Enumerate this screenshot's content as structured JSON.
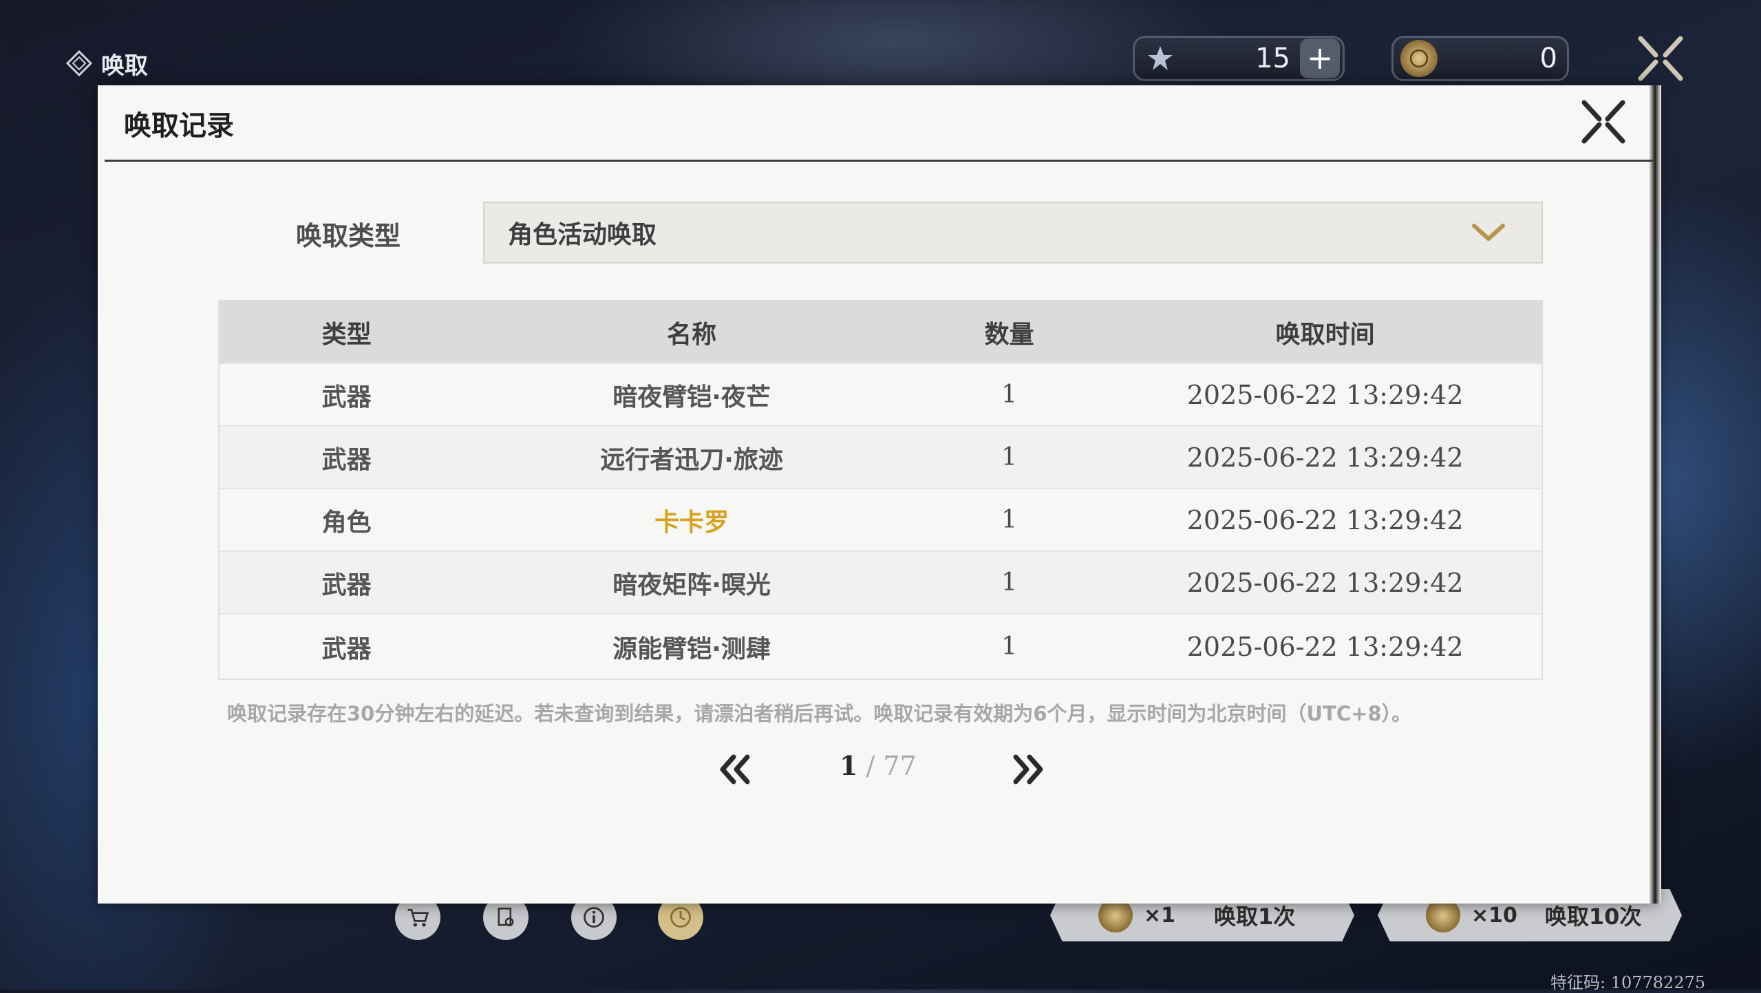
{
  "screen": {
    "title": "唤取",
    "feature_code": "特征码: 107782275"
  },
  "currencies": [
    {
      "name": "star-currency",
      "value": "15",
      "icon": "star-icon"
    },
    {
      "name": "coin-currency",
      "value": "0",
      "icon": "coin-icon"
    }
  ],
  "bottom_bar": {
    "pull_one": {
      "cost": "×1",
      "label": "唤取1次"
    },
    "pull_ten": {
      "cost": "×10",
      "label": "唤取10次"
    }
  },
  "modal": {
    "title": "唤取记录",
    "filter": {
      "label": "唤取类型",
      "value": "角色活动唤取"
    },
    "table": {
      "headers": [
        "类型",
        "名称",
        "数量",
        "唤取时间"
      ],
      "rows": [
        {
          "type": "武器",
          "name": "暗夜臂铠·夜芒",
          "qty": "1",
          "time": "2025-06-22 13:29:42",
          "highlight": false
        },
        {
          "type": "武器",
          "name": "远行者迅刀·旅迹",
          "qty": "1",
          "time": "2025-06-22 13:29:42",
          "highlight": false
        },
        {
          "type": "角色",
          "name": "卡卡罗",
          "qty": "1",
          "time": "2025-06-22 13:29:42",
          "highlight": true
        },
        {
          "type": "武器",
          "name": "暗夜矩阵·暝光",
          "qty": "1",
          "time": "2025-06-22 13:29:42",
          "highlight": false
        },
        {
          "type": "武器",
          "name": "源能臂铠·测肆",
          "qty": "1",
          "time": "2025-06-22 13:29:42",
          "highlight": false
        }
      ]
    },
    "note": "唤取记录存在30分钟左右的延迟。若未查询到结果，请漂泊者稍后再试。唤取记录有效期为6个月，显示时间为北京时间（UTC+8）。",
    "pagination": {
      "current": "1",
      "separator": " / ",
      "total": "77"
    }
  },
  "colors": {
    "highlight": "#d6a21f",
    "chevron": "#b8954a"
  }
}
